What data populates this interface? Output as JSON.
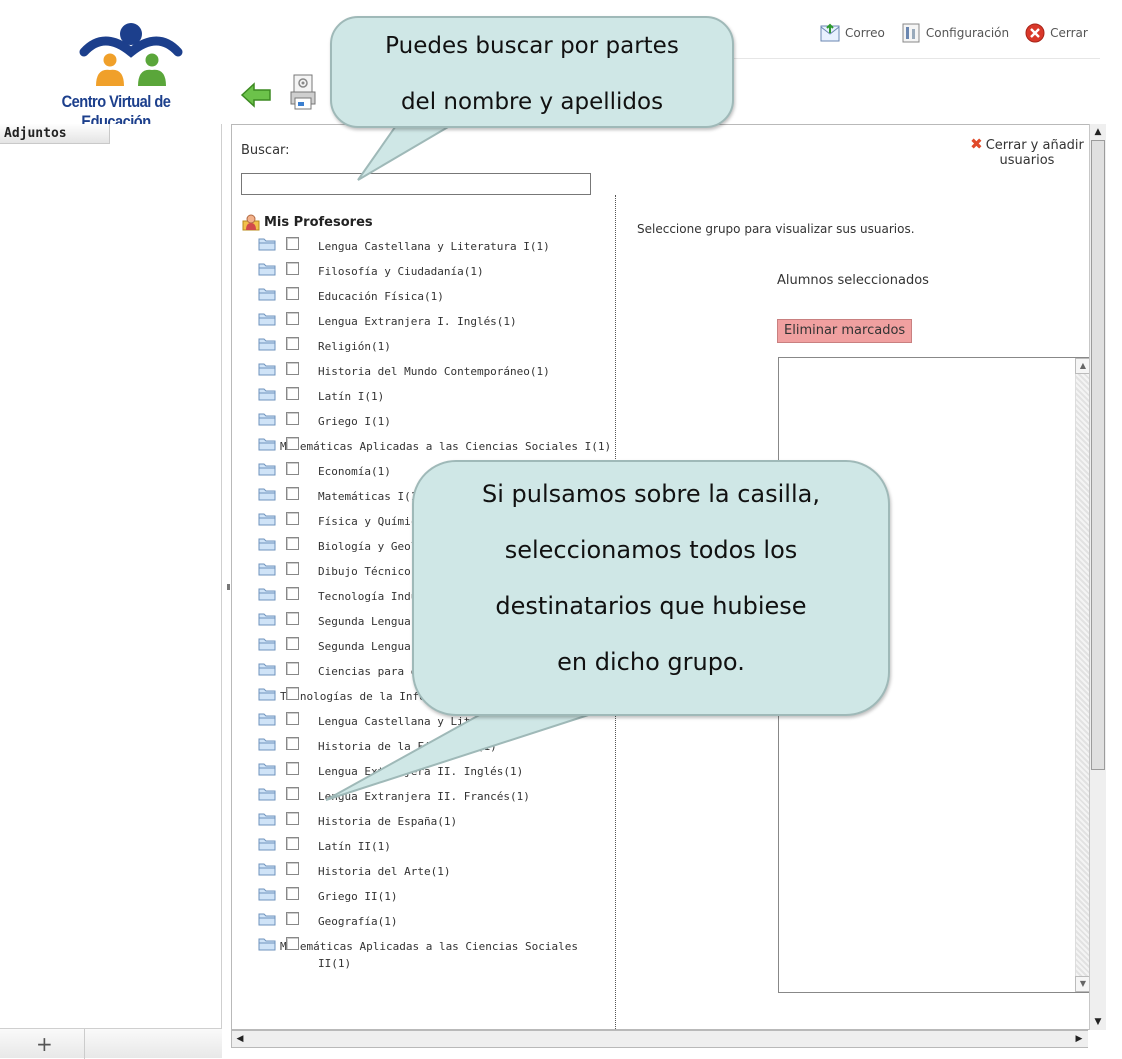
{
  "header": {
    "logo_text": "Centro Virtual de Educación",
    "top_links": [
      {
        "label": "Correo",
        "icon": "mail-icon"
      },
      {
        "label": "Configuración",
        "icon": "settings-icon"
      },
      {
        "label": "Cerrar",
        "icon": "close-session-icon"
      }
    ]
  },
  "sidebar": {
    "title": "Adjuntos",
    "add_label": "+"
  },
  "search": {
    "label": "Buscar:",
    "value": "",
    "placeholder": ""
  },
  "tree": {
    "root_label": "Mis Profesores",
    "items": [
      "Lengua Castellana y Literatura I(1)",
      "Filosofía y Ciudadanía(1)",
      "Educación Física(1)",
      "Lengua Extranjera I. Inglés(1)",
      "Religión(1)",
      "Historia del Mundo Contemporáneo(1)",
      "Latín I(1)",
      "Griego I(1)",
      "Matemáticas Aplicadas a las Ciencias Sociales I(1)",
      "Economía(1)",
      "Matemáticas I(1)",
      "Física y Química(1)",
      "Biología y Geología(1)",
      "Dibujo Técnico I(1)",
      "Tecnología Industrial I(1)",
      "Segunda Lengua Extranjera I(1)",
      "Segunda Lengua Extranjera II(1)",
      "Ciencias para el Mundo Contemporáneo(1)",
      "Tecnologías de la Información y la Comunicación(1)",
      "Lengua Castellana y Literatura II(1)",
      "Historia de la Filosofía(1)",
      "Lengua Extranjera II. Inglés(1)",
      "Lengua Extranjera II. Francés(1)",
      "Historia de España(1)",
      "Latín II(1)",
      "Historia del Arte(1)",
      "Griego II(1)",
      "Geografía(1)",
      "Matemáticas Aplicadas a las Ciencias Sociales II(1)"
    ]
  },
  "right_panel": {
    "info_text": "Seleccione grupo para visualizar sus usuarios.",
    "selected_title": "Alumnos seleccionados",
    "delete_button": "Eliminar marcados",
    "close_add_label": "Cerrar y añadir usuarios"
  },
  "callouts": {
    "search_tip_line1": "Puedes buscar por partes",
    "search_tip_line2": "del nombre y apellidos",
    "checkbox_tip_line1": "Si pulsamos sobre la casilla,",
    "checkbox_tip_line2": "seleccionamos todos los",
    "checkbox_tip_line3": "destinatarios que hubiese",
    "checkbox_tip_line4": "en dicho grupo."
  },
  "colors": {
    "logo_blue": "#1c3f8c",
    "logo_orange": "#f0a02a",
    "logo_green": "#5aa63a",
    "callout_fill": "#cfe7e6",
    "delete_button": "#f0a0a0",
    "close_x": "#e04a2a"
  }
}
